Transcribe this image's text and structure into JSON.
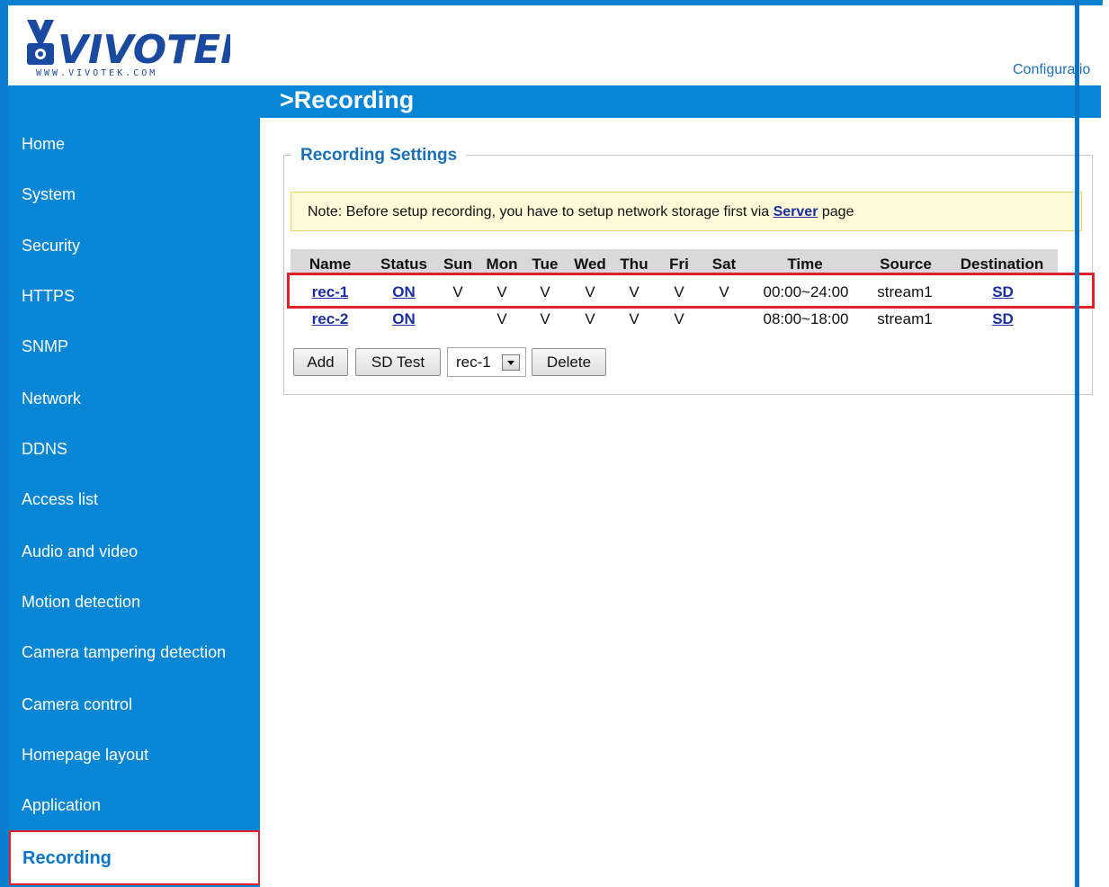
{
  "header": {
    "logo_text": "VIVOTEK",
    "logo_url_text": "WWW.VIVOTEK.COM",
    "config_link": "Configuratio",
    "page_title": ">Recording"
  },
  "sidebar": {
    "items": [
      {
        "label": "Home"
      },
      {
        "label": "System"
      },
      {
        "label": "Security"
      },
      {
        "label": "HTTPS"
      },
      {
        "label": "SNMP"
      },
      {
        "label": "Network"
      },
      {
        "label": "DDNS"
      },
      {
        "label": "Access list"
      },
      {
        "label": "Audio and video"
      },
      {
        "label": "Motion detection"
      },
      {
        "label": "Camera tampering detection"
      },
      {
        "label": "Camera control"
      },
      {
        "label": "Homepage layout"
      },
      {
        "label": "Application"
      }
    ],
    "active": "Recording"
  },
  "recording_settings": {
    "legend": "Recording Settings",
    "note": {
      "prefix": "Note: Before setup recording, you have to setup network storage first via ",
      "link": "Server",
      "suffix": " page"
    },
    "columns": [
      "Name",
      "Status",
      "Sun",
      "Mon",
      "Tue",
      "Wed",
      "Thu",
      "Fri",
      "Sat",
      "Time",
      "Source",
      "Destination"
    ],
    "rows": [
      {
        "name": "rec-1",
        "status": "ON",
        "sun": "V",
        "mon": "V",
        "tue": "V",
        "wed": "V",
        "thu": "V",
        "fri": "V",
        "sat": "V",
        "time": "00:00~24:00",
        "source": "stream1",
        "destination": "SD"
      },
      {
        "name": "rec-2",
        "status": "ON",
        "sun": "",
        "mon": "V",
        "tue": "V",
        "wed": "V",
        "thu": "V",
        "fri": "V",
        "sat": "",
        "time": "08:00~18:00",
        "source": "stream1",
        "destination": "SD"
      }
    ],
    "buttons": {
      "add": "Add",
      "sd_test": "SD Test",
      "delete": "Delete"
    },
    "select": {
      "value": "rec-1"
    }
  },
  "colors": {
    "accent_blue": "#0886d6",
    "highlight_red": "#e2202a",
    "note_bg": "#fffbd8"
  }
}
